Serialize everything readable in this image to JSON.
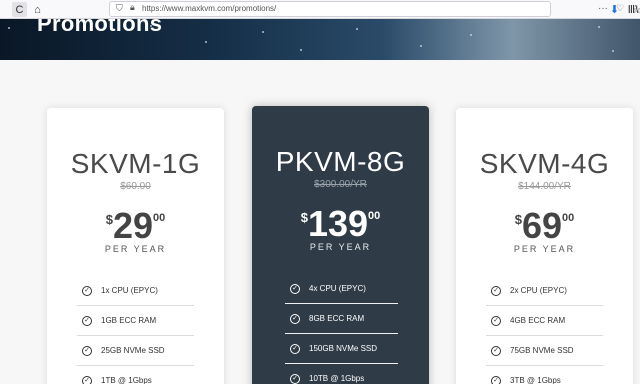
{
  "browser": {
    "url": "https://www.maxkvm.com/promotions/",
    "reload_icon": "C",
    "home_icon": "⌂",
    "dots_icon": "···",
    "pocket_icon": "♡",
    "star_icon": "☆",
    "download_icon": "⬇",
    "library_icon": "Ⅲ\\"
  },
  "hero": {
    "title": "Promotions"
  },
  "plans": [
    {
      "name": "SKVM-1G",
      "old_price": "$60.00",
      "currency": "$",
      "amount": "29",
      "cents": "00",
      "period": "PER YEAR",
      "features": [
        "1x CPU (EPYC)",
        "1GB ECC RAM",
        "25GB NVMe SSD",
        "1TB @ 1Gbps"
      ]
    },
    {
      "name": "PKVM-8G",
      "old_price": "$300.00/YR",
      "currency": "$",
      "amount": "139",
      "cents": "00",
      "period": "PER YEAR",
      "features": [
        "4x CPU (EPYC)",
        "8GB ECC RAM",
        "150GB NVMe SSD",
        "10TB @ 1Gbps"
      ]
    },
    {
      "name": "SKVM-4G",
      "old_price": "$144.00/YR",
      "currency": "$",
      "amount": "69",
      "cents": "00",
      "period": "PER YEAR",
      "features": [
        "2x CPU (EPYC)",
        "4GB ECC RAM",
        "75GB NVMe SSD",
        "3TB @ 1Gbps"
      ]
    }
  ]
}
